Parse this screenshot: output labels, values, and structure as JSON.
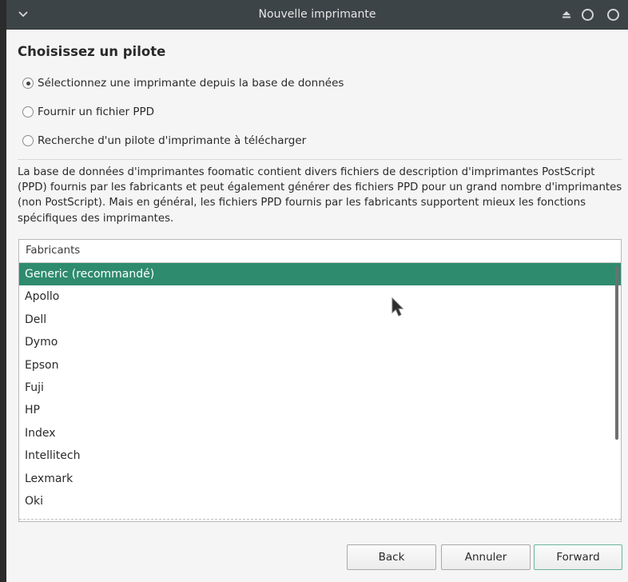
{
  "window": {
    "title": "Nouvelle imprimante"
  },
  "page": {
    "heading": "Choisissez un pilote"
  },
  "options": [
    {
      "label": "Sélectionnez une imprimante depuis la base de données",
      "checked": true
    },
    {
      "label": "Fournir un fichier PPD",
      "checked": false
    },
    {
      "label": "Recherche d'un pilote d'imprimante à télécharger",
      "checked": false
    }
  ],
  "description": "La base de données d'imprimantes foomatic contient divers fichiers de description d'imprimantes PostScript (PPD) fournis par les fabricants et peut également générer des fichiers PPD pour un grand nombre d'imprimantes (non PostScript). Mais en général, les fichiers PPD fournis par les fabricants supportent mieux les fonctions spécifiques des imprimantes.",
  "manufacturers": {
    "header": "Fabricants",
    "selected": "Generic (recommandé)",
    "items": [
      "Generic (recommandé)",
      "Apollo",
      "Dell",
      "Dymo",
      "Epson",
      "Fuji",
      "HP",
      "Index",
      "Intellitech",
      "Lexmark",
      "Oki"
    ]
  },
  "buttons": {
    "back": "Back",
    "cancel": "Annuler",
    "forward": "Forward"
  },
  "colors": {
    "titlebar": "#3d4447",
    "selection": "#2e8b6e",
    "window_bg": "#f5f5f5"
  },
  "icons": {
    "menu": "chevron-down-icon",
    "eject": "eject-icon",
    "minimize": "minimize-icon",
    "maximize": "maximize-icon",
    "cursor": "mouse-cursor-icon"
  }
}
